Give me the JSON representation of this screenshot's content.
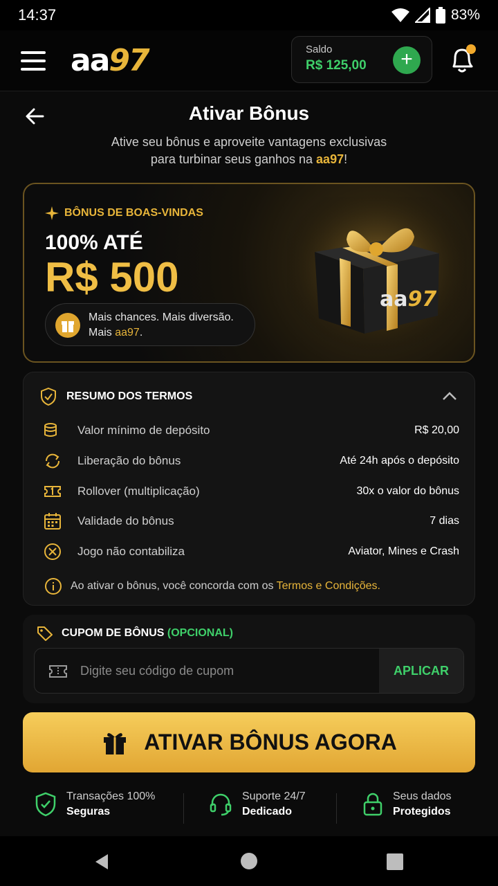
{
  "status_bar": {
    "time": "14:37",
    "battery": "83%"
  },
  "app_bar": {
    "logo_left": "aa",
    "logo_right": "97",
    "balance_label": "Saldo",
    "balance_value": "R$ 125,00",
    "add_icon": "plus-icon",
    "notification_icon": "bell-icon"
  },
  "header": {
    "title": "Ativar Bônus",
    "subtitle_line1": "Ative seu bônus e aproveite vantagens exclusivas",
    "subtitle_line2_prefix": "para turbinar seus ganhos na ",
    "subtitle_brand": "aa97",
    "subtitle_suffix": "!"
  },
  "hero": {
    "tag": "BÔNUS DE BOAS-VINDAS",
    "line1": "100% ATÉ",
    "amount": "R$ 500",
    "pill_line1": "Mais chances. Mais diversão.",
    "pill_line2_prefix": "Mais ",
    "pill_brand": "aa97",
    "pill_suffix": ".",
    "box_brand_left": "aa",
    "box_brand_right": "97"
  },
  "terms": {
    "title": "RESUMO DOS TERMOS",
    "rows": [
      {
        "icon": "coins-icon",
        "label": "Valor mínimo de depósito",
        "value": "R$ 20,00"
      },
      {
        "icon": "refresh-icon",
        "label": "Liberação do bônus",
        "value": "Até 24h após o depósito"
      },
      {
        "icon": "ticket-icon",
        "label": "Rollover (multiplicação)",
        "value": "30x o valor do bônus"
      },
      {
        "icon": "calendar-icon",
        "label": "Validade do bônus",
        "value": "7 dias"
      },
      {
        "icon": "x-circle-icon",
        "label": "Jogo não contabiliza",
        "value": "Aviator, Mines e Crash"
      }
    ],
    "note_prefix": "Ao ativar o bônus, você concorda com os ",
    "note_link": "Termos e Condições."
  },
  "coupon": {
    "title": "CUPOM DE BÔNUS",
    "optional": "(OPCIONAL)",
    "placeholder": "Digite seu código de cupom",
    "apply_label": "APLICAR"
  },
  "cta": {
    "label": "ATIVAR BÔNUS AGORA"
  },
  "trust": [
    {
      "icon": "shield-check-icon",
      "line1": "Transações 100%",
      "line2": "Seguras"
    },
    {
      "icon": "headset-icon",
      "line1": "Suporte 24/7",
      "line2": "Dedicado"
    },
    {
      "icon": "lock-icon",
      "line1": "Seus dados",
      "line2": "Protegidos"
    }
  ],
  "colors": {
    "gold": "#e8b53a",
    "green": "#3fd06a",
    "background": "#0b0b0b"
  }
}
